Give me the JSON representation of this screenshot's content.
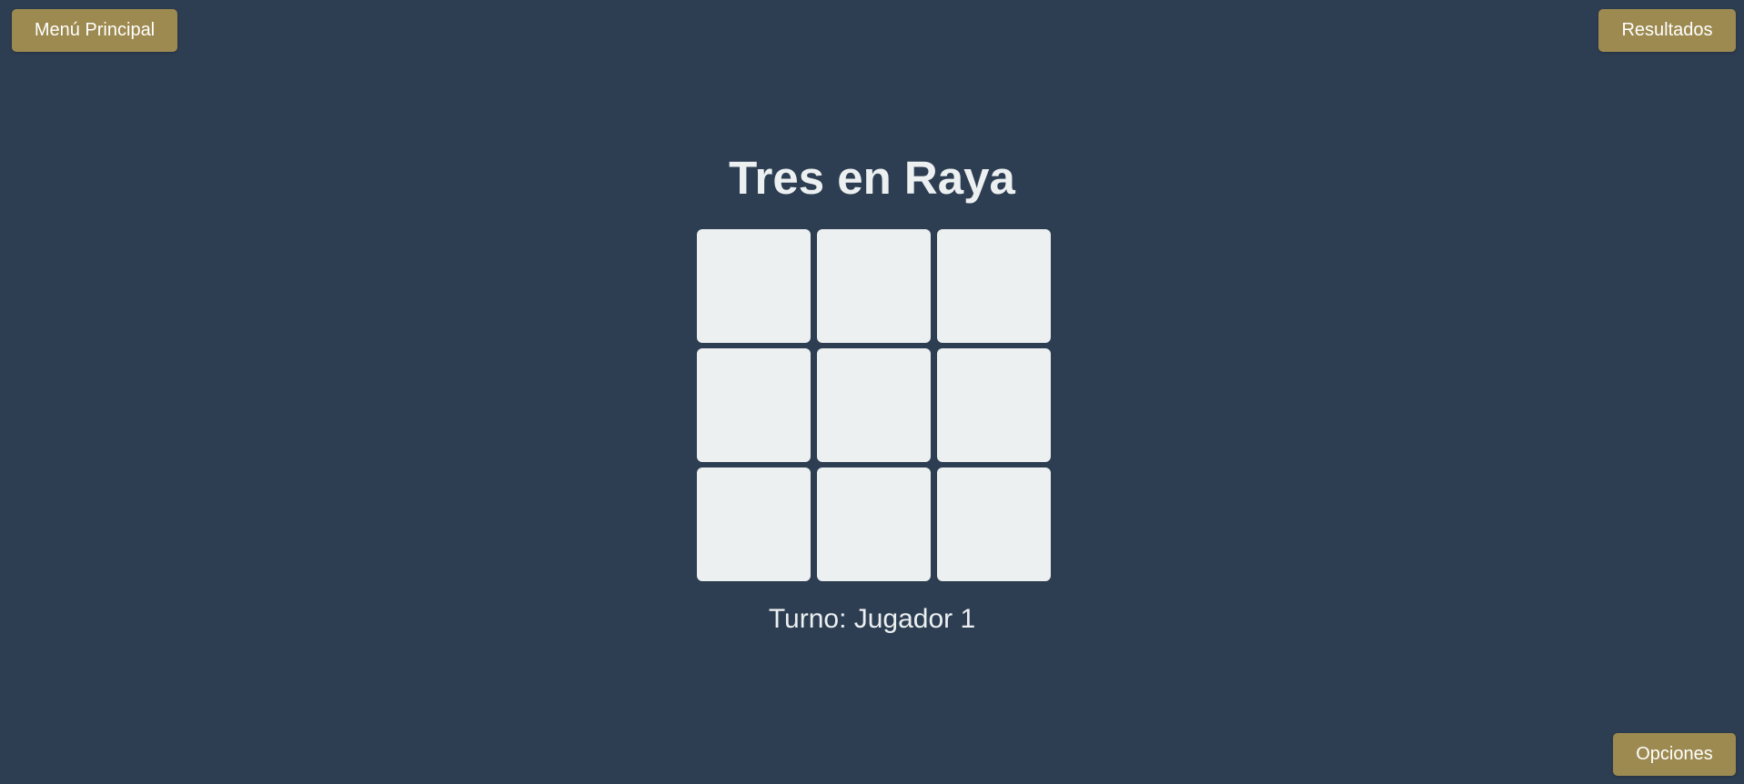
{
  "nav": {
    "menu_label": "Menú Principal",
    "results_label": "Resultados",
    "options_label": "Opciones"
  },
  "game": {
    "title": "Tres en Raya",
    "board": [
      "",
      "",
      "",
      "",
      "",
      "",
      "",
      "",
      ""
    ],
    "turn_prefix": "Turno: ",
    "current_player": "Jugador 1"
  },
  "colors": {
    "background": "#2e3e52",
    "button": "#9d8a50",
    "cell": "#ecf0f1",
    "text": "#ecf0f1"
  }
}
